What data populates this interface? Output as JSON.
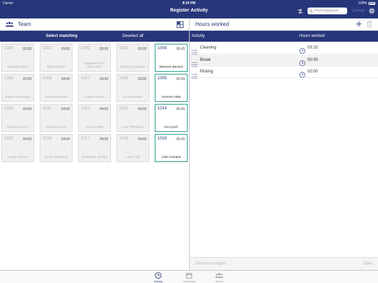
{
  "status_bar": {
    "carrier": "Carrier",
    "time": "8:24 PM",
    "battery": "100%"
  },
  "nav": {
    "title": "Register Activity",
    "search_placeholder": "Find employees",
    "cancel_label": "Cancel"
  },
  "left_panel": {
    "title": "Team",
    "select_matching_label": "Select matching",
    "deselect_all_label": "Deselect all",
    "employees": [
      {
        "num": "1000",
        "hours": "03:00",
        "name": "Montana Stout",
        "selected": false
      },
      {
        "num": "1001",
        "hours": "03:00",
        "name": "Tasha Bonner",
        "selected": false
      },
      {
        "num": "1002",
        "hours": "03:00",
        "name": "Sapphire de la Davenport",
        "selected": false
      },
      {
        "num": "1003",
        "hours": "03:00",
        "name": "Brittany Emerson",
        "selected": false
      },
      {
        "num": "1004",
        "hours": "05:45",
        "name": "Blossom Benson",
        "selected": true
      },
      {
        "num": "1005",
        "hours": "03:00",
        "name": "Jayme Mccullough",
        "selected": false
      },
      {
        "num": "1006",
        "hours": "03:00",
        "name": "Ashely Schwartz",
        "selected": false
      },
      {
        "num": "1007",
        "hours": "03:00",
        "name": "Leilani Forbes",
        "selected": false
      },
      {
        "num": "1008",
        "hours": "03:00",
        "name": "Alice Edwards",
        "selected": false
      },
      {
        "num": "1009",
        "hours": "05:45",
        "name": "Summer Hale",
        "selected": true
      },
      {
        "num": "1010",
        "hours": "04:00",
        "name": "Laurel Oconnor",
        "selected": false
      },
      {
        "num": "1011",
        "hours": "04:00",
        "name": "Angelica Short",
        "selected": false
      },
      {
        "num": "1012",
        "hours": "04:00",
        "name": "Serina Keller",
        "selected": false
      },
      {
        "num": "1013",
        "hours": "04:00",
        "name": "Leel Thompson",
        "selected": false
      },
      {
        "num": "1014",
        "hours": "05:45",
        "name": "Ina Lynch",
        "selected": true
      },
      {
        "num": "1015",
        "hours": "04:00",
        "name": "Lesley Herrera",
        "selected": false
      },
      {
        "num": "1016",
        "hours": "04:00",
        "name": "Shelly Robertson",
        "selected": false
      },
      {
        "num": "1017",
        "hours": "04:00",
        "name": "Quintessa Jacobs",
        "selected": false
      },
      {
        "num": "1018",
        "hours": "04:00",
        "name": "Lacey Hill",
        "selected": false
      },
      {
        "num": "1019",
        "hours": "05:45",
        "name": "Lilah Campos",
        "selected": true
      }
    ]
  },
  "right_panel": {
    "title": "Hours worked",
    "col_activity": "Activity",
    "col_hours": "Hours worked",
    "activities": [
      {
        "name": "Cleaning",
        "hours": "03:15",
        "active": false
      },
      {
        "name": "Break",
        "hours": "00:30",
        "active": true
      },
      {
        "name": "Picking",
        "hours": "02:00",
        "active": false
      }
    ],
    "discard_label": "Discard changes",
    "save_label": "Save"
  },
  "tabs": [
    {
      "label": "Activity",
      "active": true
    },
    {
      "label": "Timesheet",
      "active": false
    },
    {
      "label": "Teams",
      "active": false
    }
  ],
  "colors": {
    "brand": "#27367a",
    "selection": "#2a9f8f",
    "cell_bg": "#f1efef"
  }
}
